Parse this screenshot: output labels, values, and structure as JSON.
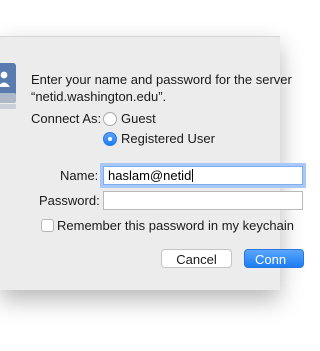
{
  "dialog": {
    "prompt_line1": "Enter your name and password for the server",
    "prompt_line2": "“netid.washington.edu”.",
    "connect_as_label": "Connect As:",
    "options": {
      "guest": "Guest",
      "registered": "Registered User"
    },
    "selected_option": "Registered User",
    "name_label": "Name:",
    "name_value": "haslam@netid",
    "password_label": "Password:",
    "password_value": "",
    "remember_label": "Remember this password in my keychain",
    "remember_checked": false,
    "cancel_label": "Cancel",
    "connect_label": "Conn"
  },
  "colors": {
    "accent": "#1e7cf2",
    "dialog_bg": "#ececec"
  },
  "icons": {
    "server": "network-server-icon"
  }
}
